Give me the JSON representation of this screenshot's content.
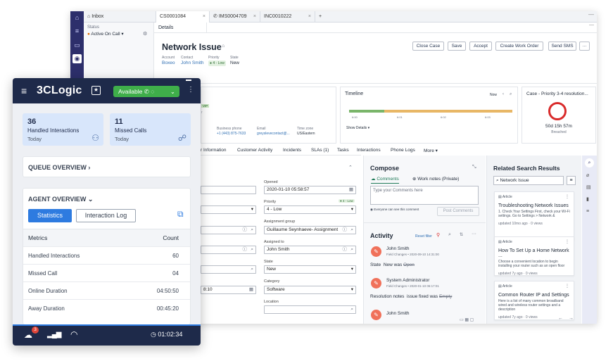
{
  "servicenow": {
    "tabs": {
      "inbox": "Inbox",
      "case": "CS0001084",
      "ims": "IMS0004709",
      "inc": "INC0010222",
      "add": "+"
    },
    "left": {
      "status_label": "Status",
      "status_value": "Active On Call"
    },
    "subtab": "Details",
    "record": {
      "title": "Network Issue",
      "account_label": "Account",
      "account_value": "Boxeo",
      "contact_label": "Contact",
      "contact_value": "John Smith",
      "priority_label": "Priority",
      "priority_value": "4 - Low",
      "state_label": "State",
      "state_value": "New"
    },
    "buttons": {
      "close_case": "Close Case",
      "save": "Save",
      "accept": "Accept",
      "create_work_order": "Create Work Order",
      "send_sms": "Send SMS",
      "more": "···"
    },
    "info_card": {
      "vip_badge": "VIP",
      "business_phone_label": "Business phone",
      "business_phone_value": "+1 (443) 875-7633",
      "email_label": "Email",
      "email_value": "greyslevecontact@...",
      "timezone_label": "Time zone",
      "timezone_value": "US/Eastern"
    },
    "timeline": {
      "title": "Timeline",
      "now": "Now",
      "show_details": "Show Details",
      "ticks": [
        "6:00",
        "6:01",
        "6:02",
        "6:03"
      ]
    },
    "sla_card": {
      "title": "Case - Priority 3-4 resolution...",
      "time": "50d 15h 57m",
      "status": "Breached"
    },
    "record_tabs": [
      "r Information",
      "Customer Activity",
      "Incidents",
      "SLAs (1)",
      "Tasks",
      "Interactions",
      "Phone Logs",
      "More"
    ],
    "form": {
      "opened_label": "Opened",
      "opened_value": "2020-01-10 05:58:57",
      "priority_label": "Priority",
      "priority_badge": "4 - Low",
      "priority_value": "4 - Low",
      "assignment_group_label": "Assignment group",
      "assignment_group_value": "Guillaume Seynhaeve- Assignment",
      "assigned_to_label": "Assigned to",
      "assigned_to_value": "John Smith",
      "state_label": "State",
      "state_value": "New",
      "category_label": "Category",
      "category_value": "Software",
      "location_label": "Location",
      "partial_time": "8:10"
    },
    "compose": {
      "title": "Compose",
      "tab_comments": "Comments",
      "tab_work_notes": "Work notes (Private)",
      "placeholder": "Type your Comments here",
      "visibility": "Everyone can see this comment",
      "post": "Post Comments"
    },
    "activity": {
      "title": "Activity",
      "reset_filter": "Reset filter",
      "items": [
        {
          "name": "John Smith",
          "meta": "Field Changes • 2020-09-10 14:31:00",
          "field": "State",
          "new": "New",
          "was_word": "was",
          "old": "Open"
        },
        {
          "name": "System Administrator",
          "meta": "Field Changes • 2020-01-10 06:17:01",
          "field": "Resolution notes",
          "new": "issue fixed",
          "was_word": "was",
          "old": "Empty"
        },
        {
          "name": "John Smith",
          "meta": "",
          "field": "",
          "new": "",
          "was_word": "",
          "old": ""
        }
      ]
    },
    "related": {
      "title": "Related Search Results",
      "search_value": "Network Issue",
      "cards": [
        {
          "kind": "Article",
          "title": "Troubleshooting Network Issues",
          "desc": "1. Check Your Settings First, check your Wi-Fi settings. Go to Settings > Network &",
          "updated": "updated 10mo ago · 0 views"
        },
        {
          "kind": "Article",
          "title": "How To Set Up a Home Network ...",
          "desc": "Choose a convenient location to begin installing your router such as an open floor",
          "updated": "updated 7y ago · 0 views"
        },
        {
          "kind": "Article",
          "title": "Common Router IP and Settings",
          "desc": "Here is a list of many common broadband wired and wireless router settings and a description",
          "updated": "updated 7y ago · 0 views"
        }
      ]
    }
  },
  "threecl": {
    "logo": "3CLogic",
    "availability": "Available",
    "stats": [
      {
        "number": "36",
        "label": "Handled Interactions",
        "period": "Today"
      },
      {
        "number": "11",
        "label": "Missed Calls",
        "period": "Today"
      }
    ],
    "queue_overview": "QUEUE OVERVIEW",
    "agent_overview": "AGENT OVERVIEW",
    "tab_statistics": "Statistics",
    "tab_interaction_log": "Interaction Log",
    "metrics_header": "Metrics",
    "count_header": "Count",
    "metrics": [
      {
        "label": "Handled Interactions",
        "value": "60"
      },
      {
        "label": "Missed Call",
        "value": "04"
      },
      {
        "label": "Online Duration",
        "value": "04:50:50"
      },
      {
        "label": "Away Duration",
        "value": "00:45:20"
      }
    ],
    "footer": {
      "badge": "3",
      "timer": "01:02:34"
    },
    "colors": {
      "header": "#1e2a4a",
      "available": "#3fae4a",
      "primary": "#2e7be0"
    }
  }
}
